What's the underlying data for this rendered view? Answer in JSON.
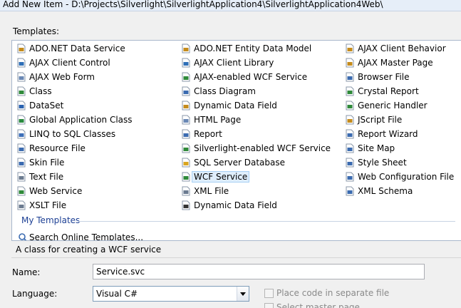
{
  "title": "Add New Item - D:\\Projects\\Silverlight\\SilverlightApplication4\\SilverlightApplication4Web\\",
  "templates_label": "Templates:",
  "columns": [
    [
      {
        "label": "ADO.NET Data Service",
        "icon": "data-service-icon",
        "color": "#c58b1b"
      },
      {
        "label": "AJAX Client Control",
        "icon": "ajax-control-icon",
        "color": "#2f6fb7"
      },
      {
        "label": "AJAX Web Form",
        "icon": "web-form-icon",
        "color": "#6a88b5"
      },
      {
        "label": "Class",
        "icon": "class-icon",
        "color": "#2f8a3a"
      },
      {
        "label": "DataSet",
        "icon": "dataset-icon",
        "color": "#2a63b0"
      },
      {
        "label": "Global Application Class",
        "icon": "global-app-icon",
        "color": "#2a8a3f"
      },
      {
        "label": "LINQ to SQL Classes",
        "icon": "linq-icon",
        "color": "#3d6fb8"
      },
      {
        "label": "Resource File",
        "icon": "resource-file-icon",
        "color": "#3b6bb0"
      },
      {
        "label": "Skin File",
        "icon": "skin-file-icon",
        "color": "#3b6bb0"
      },
      {
        "label": "Text File",
        "icon": "text-file-icon",
        "color": "#6b7b90"
      },
      {
        "label": "Web Service",
        "icon": "web-service-icon",
        "color": "#2f8a3a"
      },
      {
        "label": "XSLT File",
        "icon": "xslt-file-icon",
        "color": "#6b7b90"
      }
    ],
    [
      {
        "label": "ADO.NET Entity Data Model",
        "icon": "entity-model-icon",
        "color": "#c58b1b"
      },
      {
        "label": "AJAX Client Library",
        "icon": "ajax-library-icon",
        "color": "#2f6fb7"
      },
      {
        "label": "AJAX-enabled WCF Service",
        "icon": "wcf-service-icon",
        "color": "#2f8a3a"
      },
      {
        "label": "Class Diagram",
        "icon": "class-diagram-icon",
        "color": "#3b6bb0"
      },
      {
        "label": "Dynamic Data Field",
        "icon": "dynamic-data-icon",
        "color": "#c58b1b"
      },
      {
        "label": "HTML Page",
        "icon": "html-page-icon",
        "color": "#6a88b5"
      },
      {
        "label": "Report",
        "icon": "report-icon",
        "color": "#3b6bb0"
      },
      {
        "label": "Silverlight-enabled WCF Service",
        "icon": "silverlight-wcf-icon",
        "color": "#2f8a3a"
      },
      {
        "label": "SQL Server Database",
        "icon": "database-icon",
        "color": "#d9a520"
      },
      {
        "label": "WCF Service",
        "icon": "wcf-service-icon",
        "color": "#2f8a3a",
        "selected": true
      },
      {
        "label": "XML File",
        "icon": "xml-file-icon",
        "color": "#6b7b90"
      },
      {
        "label": "Dynamic Data Field",
        "icon": "dynamic-data-icon",
        "color": "#333333"
      }
    ],
    [
      {
        "label": "AJAX Client Behavior",
        "icon": "ajax-behavior-icon",
        "color": "#c58b1b"
      },
      {
        "label": "AJAX Master Page",
        "icon": "master-page-icon",
        "color": "#c58b1b"
      },
      {
        "label": "Browser File",
        "icon": "browser-file-icon",
        "color": "#3b6bb0"
      },
      {
        "label": "Crystal Report",
        "icon": "crystal-report-icon",
        "color": "#2f8a3a"
      },
      {
        "label": "Generic Handler",
        "icon": "generic-handler-icon",
        "color": "#2f8a3a"
      },
      {
        "label": "JScript File",
        "icon": "jscript-file-icon",
        "color": "#c58b1b"
      },
      {
        "label": "Report Wizard",
        "icon": "report-wizard-icon",
        "color": "#3b6bb0"
      },
      {
        "label": "Site Map",
        "icon": "site-map-icon",
        "color": "#3b6bb0"
      },
      {
        "label": "Style Sheet",
        "icon": "style-sheet-icon",
        "color": "#3b6bb0"
      },
      {
        "label": "Web Configuration File",
        "icon": "web-config-icon",
        "color": "#3b6bb0"
      },
      {
        "label": "XML Schema",
        "icon": "xml-schema-icon",
        "color": "#3b6bb0"
      }
    ]
  ],
  "my_templates_label": "My Templates",
  "search_online_label": "Search Online Templates...",
  "description": "A class for creating a WCF service",
  "name": {
    "label": "Name:",
    "value": "Service.svc"
  },
  "language": {
    "label": "Language:",
    "value": "Visual C#"
  },
  "options": {
    "separate_file_label": "Place code in separate file",
    "master_page_label": "Select master page"
  }
}
